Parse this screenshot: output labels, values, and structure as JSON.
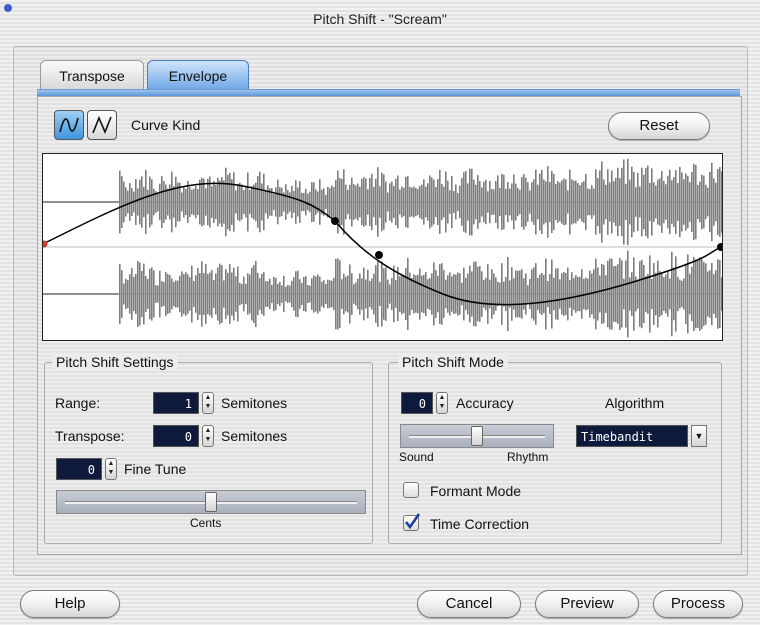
{
  "window": {
    "title": "Pitch Shift - \"Scream\""
  },
  "tabs": [
    {
      "label": "Transpose",
      "active": false
    },
    {
      "label": "Envelope",
      "active": true
    }
  ],
  "envelope": {
    "curve_kind_label": "Curve Kind",
    "curve_kinds": [
      "smooth-curve-icon",
      "sharp-curve-icon"
    ],
    "selected_curve_kind": "smooth",
    "reset_label": "Reset"
  },
  "pitch_shift_settings": {
    "title": "Pitch Shift Settings",
    "range_label": "Range:",
    "range_value": "1",
    "range_unit": "Semitones",
    "transpose_label": "Transpose:",
    "transpose_value": "0",
    "transpose_unit": "Semitones",
    "fine_tune_value": "0",
    "fine_tune_label": "Fine Tune",
    "cents_label": "Cents",
    "cents_slider_level": 0.5
  },
  "pitch_shift_mode": {
    "title": "Pitch Shift Mode",
    "accuracy_value": "0",
    "accuracy_label": "Accuracy",
    "accuracy_slider_level": 0.5,
    "sound_label": "Sound",
    "rhythm_label": "Rhythm",
    "algorithm_label": "Algorithm",
    "algorithm_value": "Timebandit",
    "formant_mode_label": "Formant Mode",
    "formant_mode_checked": false,
    "time_correction_label": "Time Correction",
    "time_correction_checked": true
  },
  "footer": {
    "help_label": "Help",
    "cancel_label": "Cancel",
    "preview_label": "Preview",
    "process_label": "Process"
  },
  "colors": {
    "accent": "#4f8fd8",
    "field_bg": "#0d1a3c",
    "waveform": "#7d7d7d",
    "envelope_handle_start": "#d23a2a"
  }
}
